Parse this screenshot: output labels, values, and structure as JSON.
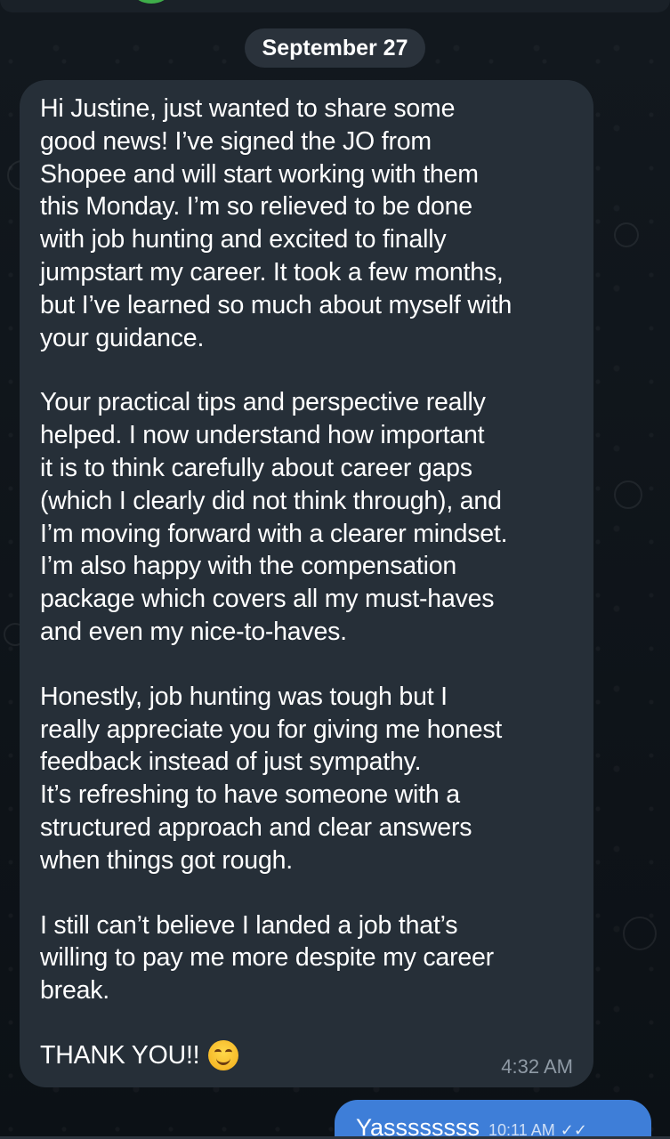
{
  "chat": {
    "date_label": "September 27",
    "incoming": {
      "paragraphs": [
        "Hi Justine, just wanted to share some\ngood news! I’ve signed the JO from\nShopee and will start working with them\nthis Monday. I’m so relieved to be done\nwith job hunting and excited to finally\njumpstart my career. It took a few months,\nbut I’ve learned so much about myself with\nyour guidance.",
        "Your practical tips and perspective really\nhelped. I now understand how important\nit is to think carefully about career gaps\n(which I clearly did not think through), and\nI’m moving forward with a clearer mindset.\nI’m also happy with the compensation\npackage which covers all my must-haves\nand even my nice-to-haves.",
        "Honestly, job hunting was tough but I\nreally appreciate you for giving me honest\nfeedback instead of just sympathy.\nIt’s refreshing to have someone with a\nstructured approach and clear answers\nwhen things got rough.",
        "I still can’t believe I landed a job that’s\nwilling to pay me more despite my career\nbreak."
      ],
      "closing": "THANK YOU!!",
      "emoji_icon": "smiling-face-emoji",
      "time": "4:32 AM"
    },
    "outgoing": {
      "text": "Yassssssss",
      "time": "10:11 AM",
      "status_icon": "double-check-icon"
    }
  },
  "colors": {
    "background": "#0f1419",
    "incoming_bubble": "#262f38",
    "outgoing_bubble": "#3e7ed8",
    "date_pill": "#2a323b"
  }
}
